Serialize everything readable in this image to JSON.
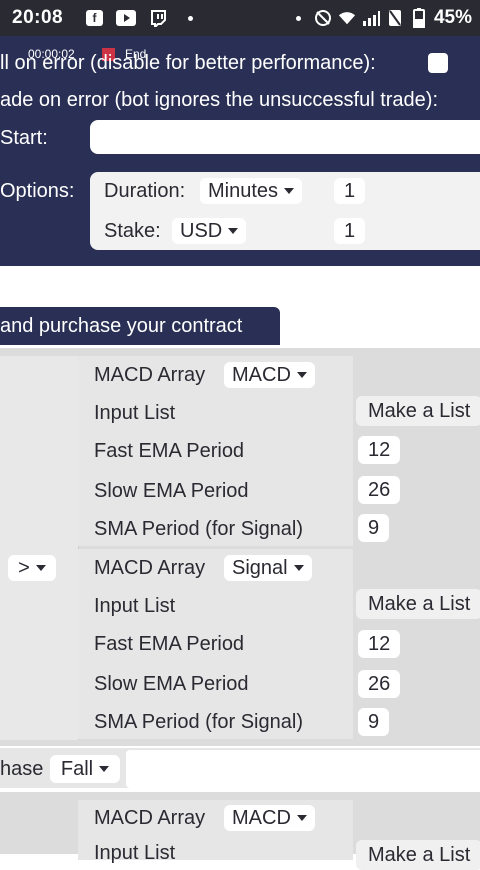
{
  "status_bar": {
    "time": "20:08",
    "battery_percent": "45%",
    "left_icons": [
      "facebook-icon",
      "youtube-icon",
      "twitch-icon",
      "dot-icon"
    ],
    "right_icons": [
      "dot-icon",
      "mute-icon",
      "wifi-icon",
      "signal-icon",
      "no-sim-icon",
      "battery-icon"
    ]
  },
  "recorder": {
    "elapsed": "00:00:02",
    "end_label": "End"
  },
  "trade_options": {
    "kill_on_error_label": "ll on error  (disable for better performance):",
    "trade_on_error_label": "ade on error  (bot ignores the unsuccessful trade):",
    "start_label": "Start:",
    "options_label": "Options:",
    "duration_label": "Duration:",
    "duration_unit": "Minutes",
    "duration_value": "1",
    "stake_label": "Stake:",
    "stake_currency": "USD",
    "stake_value": "1"
  },
  "section": {
    "title": "and purchase your contract"
  },
  "comparison": {
    "operator": ">",
    "blocks": [
      {
        "title": "MACD Array",
        "field": "MACD",
        "input_list_label": "Input List",
        "input_list_value": "Make a List",
        "fast_label": "Fast EMA Period",
        "fast_value": "12",
        "slow_label": "Slow EMA Period",
        "slow_value": "26",
        "sma_label": "SMA Period (for Signal)",
        "sma_value": "9"
      },
      {
        "title": "MACD Array",
        "field": "Signal",
        "input_list_label": "Input List",
        "input_list_value": "Make a List",
        "fast_label": "Fast EMA Period",
        "fast_value": "12",
        "slow_label": "Slow EMA Period",
        "slow_value": "26",
        "sma_label": "SMA Period (for Signal)",
        "sma_value": "9"
      }
    ]
  },
  "purchase": {
    "label": "hase",
    "direction": "Fall"
  },
  "bottom_block": {
    "title": "MACD Array",
    "field": "MACD",
    "input_list_label": "Input List",
    "input_list_value": "Make a List"
  },
  "colors": {
    "workspace_dark": "#2a3055",
    "status_bar": "#2a2a32",
    "block_grey": "#e6e6e6",
    "record_red": "#cc3344"
  }
}
